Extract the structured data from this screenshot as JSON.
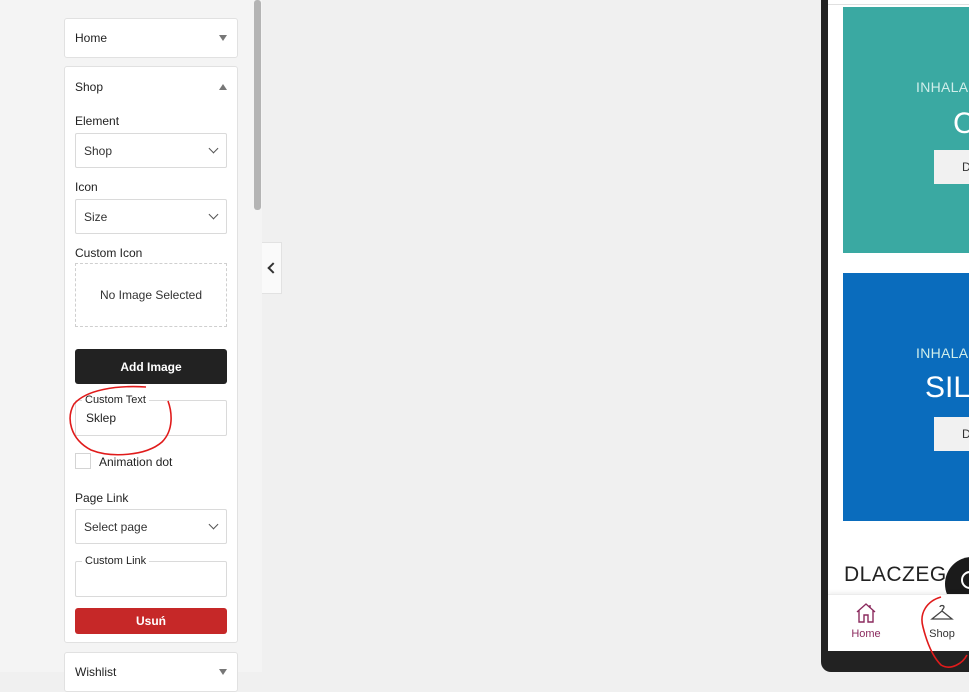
{
  "sidebar": {
    "sections": [
      {
        "label": "Home",
        "expanded": false
      },
      {
        "label": "Shop",
        "expanded": true
      },
      {
        "label": "Wishlist",
        "expanded": false
      }
    ],
    "shop_form": {
      "element_label": "Element",
      "element_value": "Shop",
      "icon_label": "Icon",
      "icon_value": "Size",
      "custom_icon_label": "Custom Icon",
      "custom_icon_empty": "No Image Selected",
      "add_image_label": "Add Image",
      "custom_text_label": "Custom Text",
      "custom_text_value": "Sklep",
      "animation_dot_label": "Animation dot",
      "animation_dot_checked": false,
      "page_link_label": "Page Link",
      "page_link_value": "Select page",
      "custom_link_label": "Custom Link",
      "custom_link_value": "",
      "remove_label": "Usuń"
    }
  },
  "preview": {
    "banners": [
      {
        "subtitle": "INHALA",
        "title": "C",
        "button": "D",
        "color": "#3aa9a2"
      },
      {
        "subtitle": "INHALA",
        "title": "SILI",
        "button": "D",
        "color": "#0a6cbd"
      }
    ],
    "section_heading": "DLACZEG",
    "bottom_nav": [
      {
        "label": "Home",
        "icon": "home-icon",
        "color": "#8b2a5e"
      },
      {
        "label": "Shop",
        "icon": "hanger-icon",
        "color": "#333333"
      }
    ]
  },
  "colors": {
    "accent_red": "#c62828",
    "dark_button": "#222222",
    "annotation_red": "#e01b1b"
  }
}
